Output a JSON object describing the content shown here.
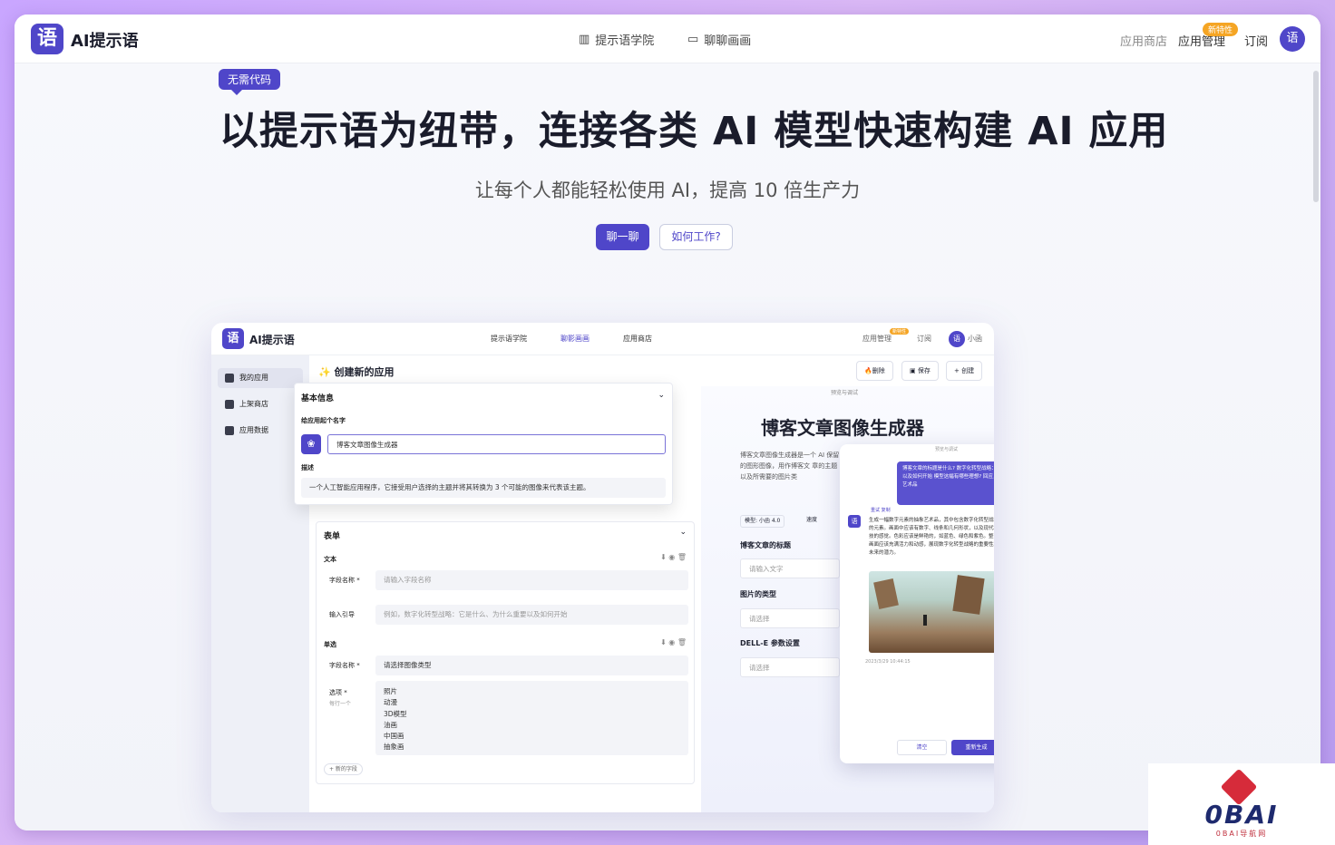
{
  "nav": {
    "logo_mark": "语",
    "logo_text": "AI提示语",
    "academy": "提示语学院",
    "chat_draw": "聊聊画画",
    "app_store": "应用商店",
    "app_manage": "应用管理",
    "new_badge": "新特性",
    "subscribe": "订阅",
    "avatar": "语"
  },
  "hero": {
    "tag": "无需代码",
    "title": "以提示语为纽带，连接各类 AI 模型快速构建 AI 应用",
    "subtitle": "让每个人都能轻松使用 AI，提高 10 倍生产力",
    "chat_btn": "聊一聊",
    "how_btn": "如何工作?"
  },
  "mock": {
    "logo_text": "AI提示语",
    "nav_academy": "提示语学院",
    "nav_chat": "聊影画画",
    "nav_store": "应用商店",
    "nav_manage": "应用管理",
    "nav_badge": "新特性",
    "nav_subscribe": "订阅",
    "nav_user": "小函",
    "side": [
      "我的应用",
      "上架商店",
      "应用数据"
    ],
    "header": "创建新的应用",
    "btn_delete": "删除",
    "btn_save": "保存",
    "btn_create": "创建",
    "basic": {
      "title": "基本信息",
      "name_label": "给应用起个名字",
      "name_value": "博客文章图像生成器",
      "desc_label": "描述",
      "desc_value": "一个人工智能应用程序，它接受用户选择的主题并将其转换为 3 个可能的图像来代表该主题。"
    },
    "form": {
      "title": "表单",
      "text_label": "文本",
      "field_name": "字段名称 *",
      "field_placeholder": "请输入字段名称",
      "guide": "输入引导",
      "guide_placeholder": "例如，数字化转型战略：它是什么、为什么重要以及如何开始",
      "radio_label": "单选",
      "radio_field_value": "请选择图像类型",
      "options_label": "选项 *",
      "options_hint": "每行一个",
      "options": [
        "照片",
        "动漫",
        "3D模型",
        "油画",
        "中国画",
        "抽象画"
      ],
      "add_field": "+ 新的字段"
    },
    "preview": {
      "label": "预览与调试",
      "title": "博客文章图像生成器",
      "desc": "博客文章图像生成器是一个 AI 保留的图形图像，用作博客文 章的主题以及所需要的图片类",
      "model": "模型: 小函 4.0",
      "speed": "速度",
      "q1": "博客文章的标题",
      "q1_ph": "请输入文字",
      "q2": "图片的类型",
      "q2_ph": "请选择",
      "q3": "DELL-E 参数设置",
      "q3_ph": "请选择"
    },
    "chat": {
      "label": "预览与调试",
      "user_msg": "博客文章的标题是什么? 数字化转型战略：它是什么、为什么重要以及如何开始 模型这幅有哪些理想? 回应，是以数字元素的抽象艺术品",
      "retry": "重试",
      "copy": "复制",
      "reply": "生成一幅数字元素的抽象艺术品，其中包含数字化转型战略的元素。画面中应该有数字、线条和几何形状，以及现代科技的感觉。色彩应该是鲜艳的，如蓝色、绿色和紫色。整个画面应该充满活力和动感，展现数字化转型战略的重要性和未来的潜力。",
      "time": "2023/3/29 10:44:15",
      "clear": "清空",
      "regen": "重新生成"
    }
  },
  "watermark": {
    "brand": "0BAI",
    "sub": "0BAI导航网"
  }
}
